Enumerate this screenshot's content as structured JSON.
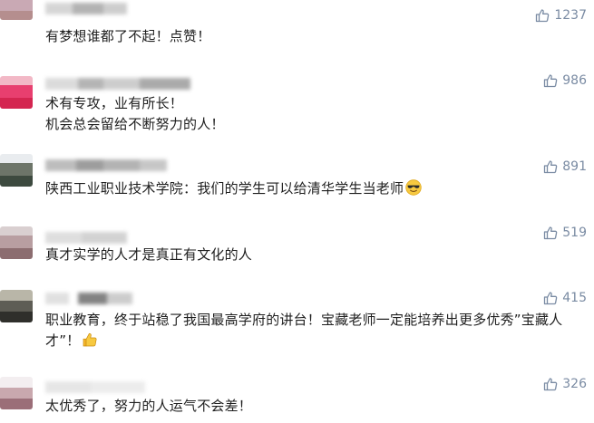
{
  "colors": {
    "like_color": "#7a8ba3",
    "text_color": "#1f1f1f",
    "background": "#ffffff"
  },
  "comments": [
    {
      "text": "有梦想谁都了不起！点赞！",
      "likes": "1237",
      "avatar_colors": [
        "#d8d0d4",
        "#c9a9b4",
        "#b58e8e"
      ]
    },
    {
      "text": "术有专攻，业有所长！\n机会总会留给不断努力的人！",
      "likes": "986",
      "avatar_colors": [
        "#f2b8c6",
        "#e83f6f",
        "#d42550"
      ]
    },
    {
      "text": "陕西工业职业技术学院：我们的学生可以给清华学生当老师",
      "likes": "891",
      "emoji": "cool-face-emoji",
      "avatar_colors": [
        "#e9ecef",
        "#6d7569",
        "#3d4a3f"
      ]
    },
    {
      "text": "真才实学的人才是真正有文化的人",
      "likes": "519",
      "avatar_colors": [
        "#d9cfd0",
        "#b89ea1",
        "#8c6d70"
      ]
    },
    {
      "text": "职业教育，终于站稳了我国最高学府的讲台！宝藏老师一定能培养出更多优秀”宝藏人才”！",
      "likes": "415",
      "emoji": "thumbs-up-emoji",
      "avatar_colors": [
        "#b9b6a8",
        "#5e5d55",
        "#2f2f2b"
      ]
    },
    {
      "text": "太优秀了，努力的人运气不会差！",
      "likes": "326",
      "avatar_colors": [
        "#f3eef0",
        "#c9a8ae",
        "#9b6e78"
      ]
    }
  ]
}
